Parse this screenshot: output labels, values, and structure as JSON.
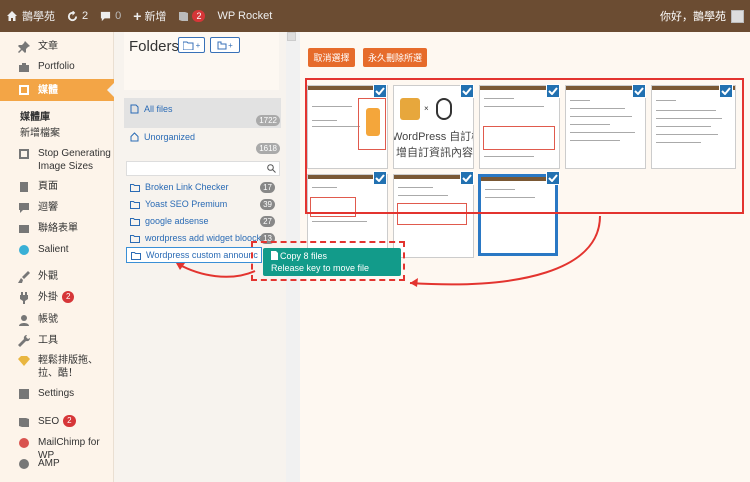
{
  "adminbar": {
    "updates_count": "2",
    "comments_count": "0",
    "site_name": "鵲學苑",
    "new_label": "新增",
    "yoast_badge": "2",
    "wp_rocket": "WP Rocket",
    "greeting": "你好，鵲學苑"
  },
  "sidebar": {
    "items": [
      {
        "label": "文章",
        "icon": "pin-icon"
      },
      {
        "label": "Portfolio",
        "icon": "portfolio-icon"
      },
      {
        "label": "媒體",
        "icon": "media-icon"
      },
      {
        "label": "Stop Generating Image Sizes",
        "icon": "stop-icon"
      },
      {
        "label": "頁面",
        "icon": "page-icon"
      },
      {
        "label": "迴響",
        "icon": "comment-icon"
      },
      {
        "label": "聯絡表單",
        "icon": "mail-icon"
      },
      {
        "label": "Salient",
        "icon": "salient-icon"
      },
      {
        "label": "外觀",
        "icon": "brush-icon"
      },
      {
        "label": "外掛",
        "icon": "plugin-icon",
        "badge": "2"
      },
      {
        "label": "帳號",
        "icon": "user-icon"
      },
      {
        "label": "工具",
        "icon": "wrench-icon"
      },
      {
        "label": "輕鬆排版拖、拉、酷！",
        "icon": "diamond-icon"
      },
      {
        "label": "Settings",
        "icon": "settings-icon"
      },
      {
        "label": "SEO",
        "icon": "yoast-icon",
        "badge": "2"
      },
      {
        "label": "MailChimp for WP",
        "icon": "mailchimp-icon"
      },
      {
        "label": "AMP",
        "icon": "amp-icon"
      }
    ],
    "submenu": {
      "library": "媒體庫",
      "add_new": "新增檔案"
    }
  },
  "folders": {
    "title": "Folders",
    "all_files": {
      "label": "All files",
      "count": "1722"
    },
    "unorganized": {
      "label": "Unorganized",
      "count": "1618"
    },
    "search_placeholder": "",
    "list": [
      {
        "label": "Broken Link Checker",
        "count": "17"
      },
      {
        "label": "Yoast SEO Premium",
        "count": "39"
      },
      {
        "label": "google adsense",
        "count": "27"
      },
      {
        "label": "wordpress add widget bloock",
        "count": "13"
      },
      {
        "label": "Wordpress custom announc",
        "count": ""
      }
    ]
  },
  "main": {
    "cancel_label": "取消選擇",
    "delete_label": "永久刪除所選",
    "drag_tooltip": {
      "line1": "Copy 8 files",
      "line2": "Release key to move file"
    },
    "thumb_text": {
      "big_title": "WordPress 自訂欄",
      "big_sub": "增自訂資訊內容"
    }
  },
  "colors": {
    "adminbar": "#6b4c32",
    "accent": "#f3a546",
    "orange_btn": "#e66b2b",
    "check_blue": "#2271b1",
    "tooltip_green": "#129b8a",
    "highlight_red": "#e3342f"
  }
}
